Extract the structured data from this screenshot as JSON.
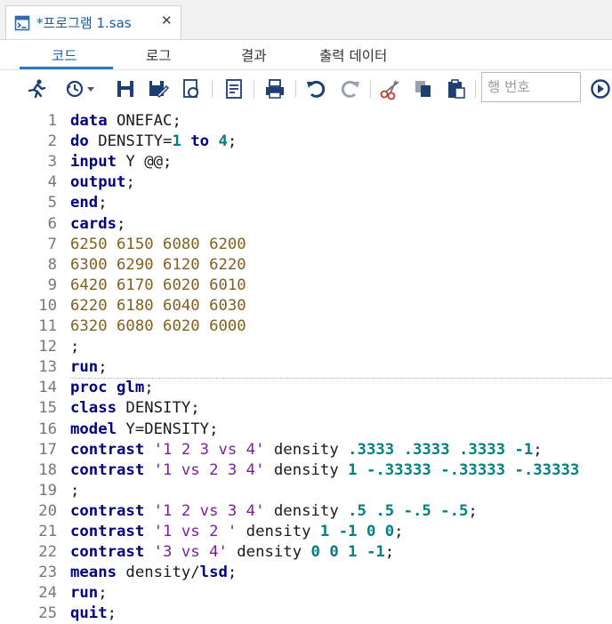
{
  "document_tab": {
    "title": "*프로그램 1.sas",
    "close_glyph": "✕",
    "icon": "sas-program-icon"
  },
  "view_tabs": [
    {
      "label": "코드",
      "active": true
    },
    {
      "label": "로그",
      "active": false
    },
    {
      "label": "결과",
      "active": false
    },
    {
      "label": "출력 데이터",
      "active": false
    }
  ],
  "toolbar": {
    "icons": [
      "run-icon",
      "history-icon",
      "save-icon",
      "save-as-icon",
      "refresh-icon",
      "log-icon",
      "print-icon",
      "undo-icon",
      "redo-icon",
      "cut-icon",
      "copy-icon",
      "paste-icon",
      "go-icon"
    ],
    "line_number_placeholder": "행 번호"
  },
  "colors": {
    "keyword": "#000080",
    "number": "#008080",
    "string": "#7b1fa2",
    "data_lines": "#806020",
    "accent": "#2f76c7"
  },
  "editor": {
    "lines": [
      {
        "n": "1",
        "tokens": [
          [
            "kw",
            "data"
          ],
          [
            "id",
            " ONEFAC;"
          ]
        ]
      },
      {
        "n": "2",
        "tokens": [
          [
            "kw",
            "do"
          ],
          [
            "id",
            " DENSITY="
          ],
          [
            "num",
            "1"
          ],
          [
            "id",
            " "
          ],
          [
            "kw",
            "to"
          ],
          [
            "id",
            " "
          ],
          [
            "num",
            "4"
          ],
          [
            "id",
            ";"
          ]
        ]
      },
      {
        "n": "3",
        "tokens": [
          [
            "kw",
            "input"
          ],
          [
            "id",
            " Y @@;"
          ]
        ]
      },
      {
        "n": "4",
        "tokens": [
          [
            "kw",
            "output"
          ],
          [
            "id",
            ";"
          ]
        ]
      },
      {
        "n": "5",
        "tokens": [
          [
            "kw",
            "end"
          ],
          [
            "id",
            ";"
          ]
        ]
      },
      {
        "n": "6",
        "tokens": [
          [
            "kw",
            "cards"
          ],
          [
            "id",
            ";"
          ]
        ]
      },
      {
        "n": "7",
        "tokens": [
          [
            "data",
            "6250 6150 6080 6200"
          ]
        ]
      },
      {
        "n": "8",
        "tokens": [
          [
            "data",
            "6300 6290 6120 6220"
          ]
        ]
      },
      {
        "n": "9",
        "tokens": [
          [
            "data",
            "6420 6170 6020 6010"
          ]
        ]
      },
      {
        "n": "10",
        "tokens": [
          [
            "data",
            "6220 6180 6040 6030"
          ]
        ]
      },
      {
        "n": "11",
        "tokens": [
          [
            "data",
            "6320 6080 6020 6000"
          ]
        ]
      },
      {
        "n": "12",
        "tokens": [
          [
            "id",
            ";"
          ]
        ]
      },
      {
        "n": "13",
        "tokens": [
          [
            "kw",
            "run"
          ],
          [
            "id",
            ";"
          ]
        ]
      },
      {
        "n": "14",
        "tokens": [
          [
            "kw",
            "proc glm"
          ],
          [
            "id",
            ";"
          ]
        ]
      },
      {
        "n": "15",
        "tokens": [
          [
            "kw",
            "class"
          ],
          [
            "id",
            " DENSITY;"
          ]
        ]
      },
      {
        "n": "16",
        "tokens": [
          [
            "kw",
            "model"
          ],
          [
            "id",
            " Y=DENSITY;"
          ]
        ]
      },
      {
        "n": "17",
        "tokens": [
          [
            "kw",
            "contrast"
          ],
          [
            "id",
            " "
          ],
          [
            "str",
            "'1 2 3 vs 4'"
          ],
          [
            "id",
            " density "
          ],
          [
            "num",
            ".3333"
          ],
          [
            "id",
            " "
          ],
          [
            "num",
            ".3333"
          ],
          [
            "id",
            " "
          ],
          [
            "num",
            ".3333"
          ],
          [
            "id",
            " "
          ],
          [
            "num",
            "-1"
          ],
          [
            "id",
            ";"
          ]
        ]
      },
      {
        "n": "18",
        "tokens": [
          [
            "kw",
            "contrast"
          ],
          [
            "id",
            " "
          ],
          [
            "str",
            "'1 vs 2 3 4'"
          ],
          [
            "id",
            " density "
          ],
          [
            "num",
            "1"
          ],
          [
            "id",
            " "
          ],
          [
            "num",
            "-.33333"
          ],
          [
            "id",
            " "
          ],
          [
            "num",
            "-.33333"
          ],
          [
            "id",
            " "
          ],
          [
            "num",
            "-.33333"
          ]
        ]
      },
      {
        "n": "19",
        "tokens": [
          [
            "id",
            ";"
          ]
        ]
      },
      {
        "n": "20",
        "tokens": [
          [
            "kw",
            "contrast"
          ],
          [
            "id",
            " "
          ],
          [
            "str",
            "'1 2 vs 3 4'"
          ],
          [
            "id",
            " density "
          ],
          [
            "num",
            ".5"
          ],
          [
            "id",
            " "
          ],
          [
            "num",
            ".5"
          ],
          [
            "id",
            " "
          ],
          [
            "num",
            "-.5"
          ],
          [
            "id",
            " "
          ],
          [
            "num",
            "-.5"
          ],
          [
            "id",
            ";"
          ]
        ]
      },
      {
        "n": "21",
        "tokens": [
          [
            "kw",
            "contrast"
          ],
          [
            "id",
            " "
          ],
          [
            "str",
            "'1 vs 2 '"
          ],
          [
            "id",
            " density "
          ],
          [
            "num",
            "1"
          ],
          [
            "id",
            " "
          ],
          [
            "num",
            "-1"
          ],
          [
            "id",
            " "
          ],
          [
            "num",
            "0"
          ],
          [
            "id",
            " "
          ],
          [
            "num",
            "0"
          ],
          [
            "id",
            ";"
          ]
        ]
      },
      {
        "n": "22",
        "tokens": [
          [
            "kw",
            "contrast"
          ],
          [
            "id",
            " "
          ],
          [
            "str",
            "'3 vs 4'"
          ],
          [
            "id",
            " density "
          ],
          [
            "num",
            "0"
          ],
          [
            "id",
            " "
          ],
          [
            "num",
            "0"
          ],
          [
            "id",
            " "
          ],
          [
            "num",
            "1"
          ],
          [
            "id",
            " "
          ],
          [
            "num",
            "-1"
          ],
          [
            "id",
            ";"
          ]
        ]
      },
      {
        "n": "23",
        "tokens": [
          [
            "kw",
            "means"
          ],
          [
            "id",
            " density/"
          ],
          [
            "kw",
            "lsd"
          ],
          [
            "id",
            ";"
          ]
        ]
      },
      {
        "n": "24",
        "tokens": [
          [
            "kw",
            "run"
          ],
          [
            "id",
            ";"
          ]
        ]
      },
      {
        "n": "25",
        "tokens": [
          [
            "kw",
            "quit"
          ],
          [
            "id",
            ";"
          ]
        ]
      }
    ]
  }
}
